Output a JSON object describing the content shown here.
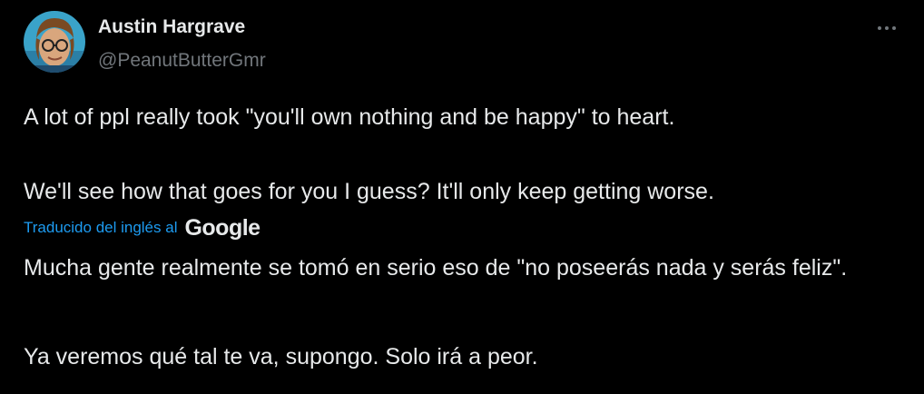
{
  "author": {
    "name": "Austin Hargrave",
    "handle": "@PeanutButterGmr",
    "avatar_icon": "avatar-photo"
  },
  "more_icon": "more-horizontal-icon",
  "original_text": {
    "line1": "A lot of ppl really took \"you'll own nothing and be happy\" to heart.",
    "line2": "We'll see how that goes for you I guess? It'll only keep getting worse."
  },
  "translation": {
    "label": "Traducido del inglés al",
    "provider": "Google",
    "line1": "Mucha gente realmente se tomó en serio eso de \"no poseerás nada y serás feliz\".",
    "line2": "Ya veremos qué tal te va, supongo. Solo irá a peor."
  },
  "colors": {
    "background": "#000000",
    "text": "#e7e9ea",
    "secondary": "#71767b",
    "link": "#1d9bf0"
  }
}
